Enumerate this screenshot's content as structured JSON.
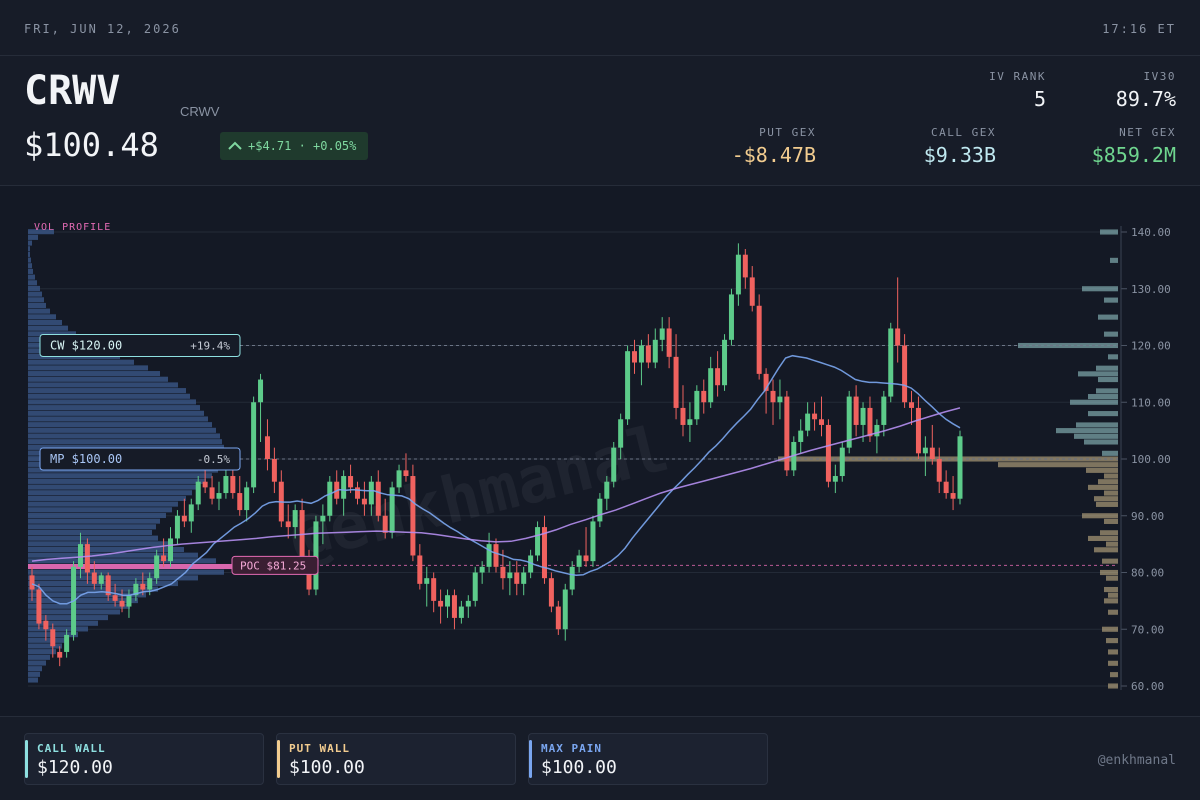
{
  "topbar": {
    "date": "FRI, JUN 12, 2026",
    "time": "17:16 ET"
  },
  "header": {
    "ticker": "CRWV",
    "name": "CRWV",
    "price": "$100.48",
    "change": "+$4.71 · +0.05%",
    "iv_rank_label": "IV RANK",
    "iv_rank": "5",
    "iv30_label": "IV30",
    "iv30": "89.7%",
    "put_gex_label": "PUT GEX",
    "put_gex": "-$8.47B",
    "call_gex_label": "CALL GEX",
    "call_gex": "$9.33B",
    "net_gex_label": "NET GEX",
    "net_gex": "$859.2M"
  },
  "colors": {
    "up": "#5dcb8a",
    "down": "#f0625f",
    "call": "#8ee0e0",
    "put": "#f2cc8f",
    "max_pain": "#7aa6f0",
    "poc": "#e46bb4",
    "ma_fast": "#7aa6f0",
    "ma_slow": "#b48ef0",
    "net_gex": "#6fd68f",
    "put_gex": "#f2cc8f",
    "call_gex": "#bfe8f0"
  },
  "footer": {
    "call_wall_label": "CALL WALL",
    "call_wall": "$120.00",
    "put_wall_label": "PUT WALL",
    "put_wall": "$100.00",
    "max_pain_label": "MAX PAIN",
    "max_pain": "$100.00",
    "handle": "@enkhmanal"
  },
  "chart_data": {
    "type": "candlestick",
    "ylim": [
      60,
      140
    ],
    "yticks": [
      60,
      70,
      80,
      90,
      100,
      110,
      120,
      130,
      140
    ],
    "ytick_labels": [
      "60.00",
      "70.00",
      "80.00",
      "90.00",
      "100.00",
      "110.00",
      "120.00",
      "130.00",
      "140.00"
    ],
    "watermark": "@enkhmanal",
    "vol_profile_label": "VOL PROFILE",
    "levels": [
      {
        "name": "call-wall",
        "label": "CW $120.00",
        "pct": "+19.4%",
        "value": 120
      },
      {
        "name": "max-pain",
        "label": "MP $100.00",
        "pct": "-0.5%",
        "value": 100
      },
      {
        "name": "poc",
        "label": "POC $81.25",
        "value": 81.25
      }
    ],
    "candles": [
      [
        79.5,
        81,
        75,
        77
      ],
      [
        77,
        78,
        70,
        71
      ],
      [
        71.5,
        72.5,
        68,
        70
      ],
      [
        70,
        71,
        65,
        67
      ],
      [
        66,
        67,
        63.5,
        65
      ],
      [
        66,
        70,
        65,
        69
      ],
      [
        69,
        82,
        68,
        81
      ],
      [
        81,
        87,
        79,
        85
      ],
      [
        85,
        86,
        78,
        80
      ],
      [
        80,
        82,
        77,
        78
      ],
      [
        78,
        80,
        77,
        79.5
      ],
      [
        79.5,
        80,
        75,
        76
      ],
      [
        76,
        78,
        74,
        75
      ],
      [
        75,
        77,
        73,
        74
      ],
      [
        74,
        77,
        72,
        76
      ],
      [
        76,
        79,
        75,
        78
      ],
      [
        78,
        80,
        76,
        77
      ],
      [
        77,
        80,
        76,
        79
      ],
      [
        79,
        84,
        78,
        83
      ],
      [
        83,
        86,
        81,
        82
      ],
      [
        82,
        88,
        81,
        86
      ],
      [
        86,
        91,
        85,
        90
      ],
      [
        90,
        93,
        88,
        89
      ],
      [
        89,
        93,
        87,
        92
      ],
      [
        92,
        97,
        91,
        96
      ],
      [
        96,
        98,
        94,
        95
      ],
      [
        95,
        97,
        92,
        93
      ],
      [
        93,
        96,
        91,
        94
      ],
      [
        94,
        98,
        93,
        97
      ],
      [
        97,
        98,
        93,
        94
      ],
      [
        94,
        97,
        90,
        91
      ],
      [
        91,
        96,
        89,
        95
      ],
      [
        95,
        111,
        94,
        110
      ],
      [
        110,
        115,
        103,
        114
      ],
      [
        104,
        107,
        98,
        100
      ],
      [
        100,
        102,
        94,
        96
      ],
      [
        96,
        98,
        88,
        89
      ],
      [
        89,
        92,
        86,
        88
      ],
      [
        88,
        92,
        86,
        91
      ],
      [
        91,
        93,
        80,
        81
      ],
      [
        81,
        84,
        76,
        77
      ],
      [
        77,
        90,
        76,
        89
      ],
      [
        89,
        92,
        85,
        90
      ],
      [
        90,
        97,
        89,
        96
      ],
      [
        96,
        98,
        92,
        93
      ],
      [
        93,
        98,
        90,
        97
      ],
      [
        97,
        99,
        94,
        95
      ],
      [
        95,
        96,
        92,
        93
      ],
      [
        93,
        96,
        90,
        92
      ],
      [
        92,
        97,
        90,
        96
      ],
      [
        96,
        98,
        89,
        90
      ],
      [
        90,
        93,
        86,
        87
      ],
      [
        87,
        96,
        86,
        95
      ],
      [
        95,
        99,
        94,
        98
      ],
      [
        98,
        101,
        96,
        97
      ],
      [
        97,
        99,
        82,
        83
      ],
      [
        83,
        85,
        77,
        78
      ],
      [
        78,
        81,
        74,
        79
      ],
      [
        79,
        80,
        73,
        75
      ],
      [
        75,
        77,
        71,
        74
      ],
      [
        74,
        77,
        72,
        76
      ],
      [
        76,
        77,
        70,
        72
      ],
      [
        72,
        75,
        71,
        74
      ],
      [
        74,
        76,
        72,
        75
      ],
      [
        75,
        81,
        74,
        80
      ],
      [
        80,
        82,
        78,
        81
      ],
      [
        81,
        87,
        80,
        85
      ],
      [
        85,
        86,
        80,
        81
      ],
      [
        81,
        84,
        77,
        79
      ],
      [
        79,
        82,
        76,
        80
      ],
      [
        80,
        82,
        76,
        78
      ],
      [
        78,
        81,
        76,
        80
      ],
      [
        80,
        84,
        79,
        83
      ],
      [
        83,
        89,
        82,
        88
      ],
      [
        88,
        90,
        78,
        79
      ],
      [
        79,
        80,
        73,
        74
      ],
      [
        74,
        75,
        69,
        70
      ],
      [
        70,
        78,
        68,
        77
      ],
      [
        77,
        82,
        76,
        81
      ],
      [
        81,
        84,
        80,
        83
      ],
      [
        83,
        88,
        81,
        82
      ],
      [
        82,
        90,
        81,
        89
      ],
      [
        89,
        94,
        88,
        93
      ],
      [
        93,
        97,
        91,
        96
      ],
      [
        96,
        103,
        95,
        102
      ],
      [
        102,
        108,
        100,
        107
      ],
      [
        107,
        120,
        106,
        119
      ],
      [
        119,
        121,
        115,
        117
      ],
      [
        117,
        121,
        113,
        120
      ],
      [
        120,
        122,
        116,
        117
      ],
      [
        117,
        123,
        116,
        121
      ],
      [
        121,
        125,
        119,
        123
      ],
      [
        123,
        125,
        116,
        118
      ],
      [
        118,
        122,
        107,
        109
      ],
      [
        109,
        113,
        104,
        106
      ],
      [
        106,
        110,
        103,
        107
      ],
      [
        107,
        113,
        106,
        112
      ],
      [
        112,
        114,
        108,
        110
      ],
      [
        110,
        118,
        109,
        116
      ],
      [
        116,
        119,
        111,
        113
      ],
      [
        113,
        122,
        112,
        121
      ],
      [
        121,
        130,
        120,
        129
      ],
      [
        129,
        138,
        127,
        136
      ],
      [
        136,
        137,
        130,
        132
      ],
      [
        132,
        134,
        126,
        127
      ],
      [
        127,
        129,
        114,
        115
      ],
      [
        115,
        116,
        108,
        112
      ],
      [
        112,
        114,
        106,
        110
      ],
      [
        110,
        114,
        107,
        111
      ],
      [
        111,
        112,
        97,
        98
      ],
      [
        98,
        104,
        97,
        103
      ],
      [
        103,
        107,
        101,
        105
      ],
      [
        105,
        110,
        104,
        108
      ],
      [
        108,
        110,
        105,
        107
      ],
      [
        107,
        111,
        104,
        106
      ],
      [
        106,
        107,
        95,
        96
      ],
      [
        96,
        99,
        94,
        97
      ],
      [
        97,
        103,
        96,
        102
      ],
      [
        102,
        112,
        101,
        111
      ],
      [
        111,
        113,
        104,
        106
      ],
      [
        106,
        110,
        103,
        109
      ],
      [
        109,
        111,
        103,
        104
      ],
      [
        104,
        107,
        101,
        106
      ],
      [
        106,
        112,
        104,
        111
      ],
      [
        111,
        124,
        110,
        123
      ],
      [
        123,
        132,
        117,
        120
      ],
      [
        120,
        122,
        109,
        110
      ],
      [
        110,
        112,
        106,
        109
      ],
      [
        109,
        111,
        100,
        101
      ],
      [
        101,
        104,
        97,
        102
      ],
      [
        102,
        106,
        99,
        100
      ],
      [
        100,
        102,
        94,
        96
      ],
      [
        96,
        98,
        93,
        94
      ],
      [
        94,
        97,
        91,
        93
      ],
      [
        93,
        105,
        92,
        104
      ]
    ],
    "ma_fast": [
      78,
      77.5,
      76,
      75,
      74.5,
      74.5,
      75,
      76,
      76.5,
      76.5,
      76.6,
      76.5,
      76.3,
      76,
      76,
      76.3,
      76.6,
      76.7,
      77,
      77.5,
      78,
      79,
      80,
      81.5,
      82.5,
      83.5,
      85,
      86,
      87,
      88,
      88.7,
      89.5,
      90.5,
      91.7,
      92.3,
      92.5,
      92.4,
      92.4,
      92.6,
      92.4,
      92.2,
      92.7,
      93.5,
      94,
      94.6,
      94.5,
      94.6,
      94.5,
      94.4,
      94.4,
      94,
      93.7,
      93.6,
      93.5,
      93,
      92,
      91.2,
      90.5,
      89.6,
      88.7,
      87.9,
      87.2,
      86.4,
      85.7,
      85,
      84.3,
      83.6,
      83.2,
      82.8,
      82.3,
      82.2,
      81.9,
      81.4,
      81,
      80.7,
      80.3,
      80,
      79.7,
      79.5,
      79.6,
      80.2,
      80.6,
      81.3,
      82,
      83,
      84.3,
      86,
      87.5,
      89,
      90.5,
      92,
      93.5,
      94.8,
      96,
      97.3,
      98.5,
      99.8,
      101.2,
      102.3,
      103.6,
      105,
      106.3,
      107.5,
      108.8,
      110.5,
      112,
      114,
      116,
      117.8,
      118.2,
      118,
      117.8,
      117.4,
      117,
      116.6,
      116.2,
      115.6,
      114.8,
      114,
      113.7,
      113.5,
      113.5,
      113.4,
      113.3,
      113.2,
      113,
      112.5,
      111.5,
      110.3,
      109.2,
      108,
      107,
      106.2,
      105.5
    ],
    "ma_slow": [
      82,
      82.3,
      82.5,
      82.7,
      82.9,
      83.2,
      83.6,
      84,
      84.4,
      84.7,
      85,
      85.2,
      85.4,
      85.6,
      85.8,
      86,
      86.3,
      86.5,
      86.7,
      86.9,
      87,
      87.1,
      87.2,
      87.3,
      87.2,
      87.1,
      87,
      86.7,
      86.3,
      85.9,
      85.6,
      85.4,
      85.5,
      86,
      86.7,
      87.5,
      88.5,
      89.3,
      90.2,
      91,
      92,
      93,
      94,
      94.8,
      95.5,
      96.2,
      96.9,
      97.6,
      98.3,
      99.1,
      99.9,
      100.7,
      101.5,
      102.2,
      102.9,
      103.6,
      104.3,
      105,
      105.8,
      106.7,
      107.5,
      108.3,
      109
    ],
    "volume_profile": [
      [
        140,
        26
      ],
      [
        139,
        10
      ],
      [
        138,
        4
      ],
      [
        137,
        2
      ],
      [
        136,
        2
      ],
      [
        135,
        3
      ],
      [
        134,
        4
      ],
      [
        133,
        5
      ],
      [
        132,
        7
      ],
      [
        131,
        9
      ],
      [
        130,
        12
      ],
      [
        129,
        14
      ],
      [
        128,
        16
      ],
      [
        127,
        18
      ],
      [
        126,
        22
      ],
      [
        125,
        28
      ],
      [
        124,
        34
      ],
      [
        123,
        40
      ],
      [
        122,
        48
      ],
      [
        121,
        62
      ],
      [
        120,
        72
      ],
      [
        119,
        80
      ],
      [
        118,
        92
      ],
      [
        117,
        106
      ],
      [
        116,
        120
      ],
      [
        115,
        132
      ],
      [
        114,
        140
      ],
      [
        113,
        150
      ],
      [
        112,
        158
      ],
      [
        111,
        162
      ],
      [
        110,
        168
      ],
      [
        109,
        172
      ],
      [
        108,
        176
      ],
      [
        107,
        180
      ],
      [
        106,
        184
      ],
      [
        105,
        188
      ],
      [
        104,
        192
      ],
      [
        103,
        194
      ],
      [
        102,
        196
      ],
      [
        101,
        198
      ],
      [
        100,
        200
      ],
      [
        99,
        196
      ],
      [
        98,
        190
      ],
      [
        97,
        184
      ],
      [
        96,
        178
      ],
      [
        95,
        172
      ],
      [
        94,
        164
      ],
      [
        93,
        158
      ],
      [
        92,
        150
      ],
      [
        91,
        144
      ],
      [
        90,
        138
      ],
      [
        89,
        132
      ],
      [
        88,
        128
      ],
      [
        87,
        124
      ],
      [
        86,
        130
      ],
      [
        85,
        142
      ],
      [
        84,
        156
      ],
      [
        83,
        170
      ],
      [
        82,
        188
      ],
      [
        81,
        210
      ],
      [
        80,
        196
      ],
      [
        79,
        170
      ],
      [
        78,
        150
      ],
      [
        77,
        130
      ],
      [
        76,
        118
      ],
      [
        75,
        110
      ],
      [
        74,
        102
      ],
      [
        73,
        92
      ],
      [
        72,
        80
      ],
      [
        71,
        70
      ],
      [
        70,
        60
      ],
      [
        69,
        50
      ],
      [
        68,
        40
      ],
      [
        67,
        34
      ],
      [
        66,
        28
      ],
      [
        65,
        22
      ],
      [
        64,
        18
      ],
      [
        63,
        14
      ],
      [
        62,
        12
      ],
      [
        61,
        10
      ]
    ],
    "gex_bars": [
      [
        140,
        "call",
        18
      ],
      [
        135,
        "call",
        8
      ],
      [
        130,
        "call",
        36
      ],
      [
        128,
        "call",
        14
      ],
      [
        125,
        "call",
        20
      ],
      [
        122,
        "call",
        14
      ],
      [
        120,
        "call",
        100
      ],
      [
        118,
        "call",
        10
      ],
      [
        116,
        "call",
        22
      ],
      [
        115,
        "call",
        40
      ],
      [
        114,
        "call",
        20
      ],
      [
        112,
        "call",
        22
      ],
      [
        111,
        "call",
        30
      ],
      [
        110,
        "call",
        48
      ],
      [
        108,
        "call",
        30
      ],
      [
        106,
        "call",
        42
      ],
      [
        105,
        "call",
        62
      ],
      [
        104,
        "call",
        44
      ],
      [
        103,
        "call",
        34
      ],
      [
        101,
        "call",
        16
      ],
      [
        100,
        "put",
        340
      ],
      [
        99,
        "put",
        120
      ],
      [
        98,
        "put",
        32
      ],
      [
        97,
        "put",
        14
      ],
      [
        96,
        "put",
        20
      ],
      [
        95,
        "put",
        30
      ],
      [
        94,
        "put",
        14
      ],
      [
        93,
        "put",
        24
      ],
      [
        92,
        "put",
        22
      ],
      [
        90,
        "put",
        36
      ],
      [
        89,
        "put",
        14
      ],
      [
        87,
        "put",
        18
      ],
      [
        86,
        "put",
        30
      ],
      [
        85,
        "put",
        12
      ],
      [
        84,
        "put",
        24
      ],
      [
        82,
        "put",
        16
      ],
      [
        80,
        "put",
        18
      ],
      [
        79,
        "put",
        12
      ],
      [
        77,
        "put",
        14
      ],
      [
        76,
        "put",
        10
      ],
      [
        75,
        "put",
        14
      ],
      [
        73,
        "put",
        10
      ],
      [
        70,
        "put",
        16
      ],
      [
        68,
        "put",
        12
      ],
      [
        66,
        "put",
        10
      ],
      [
        64,
        "put",
        10
      ],
      [
        62,
        "put",
        8
      ],
      [
        60,
        "put",
        10
      ]
    ]
  }
}
